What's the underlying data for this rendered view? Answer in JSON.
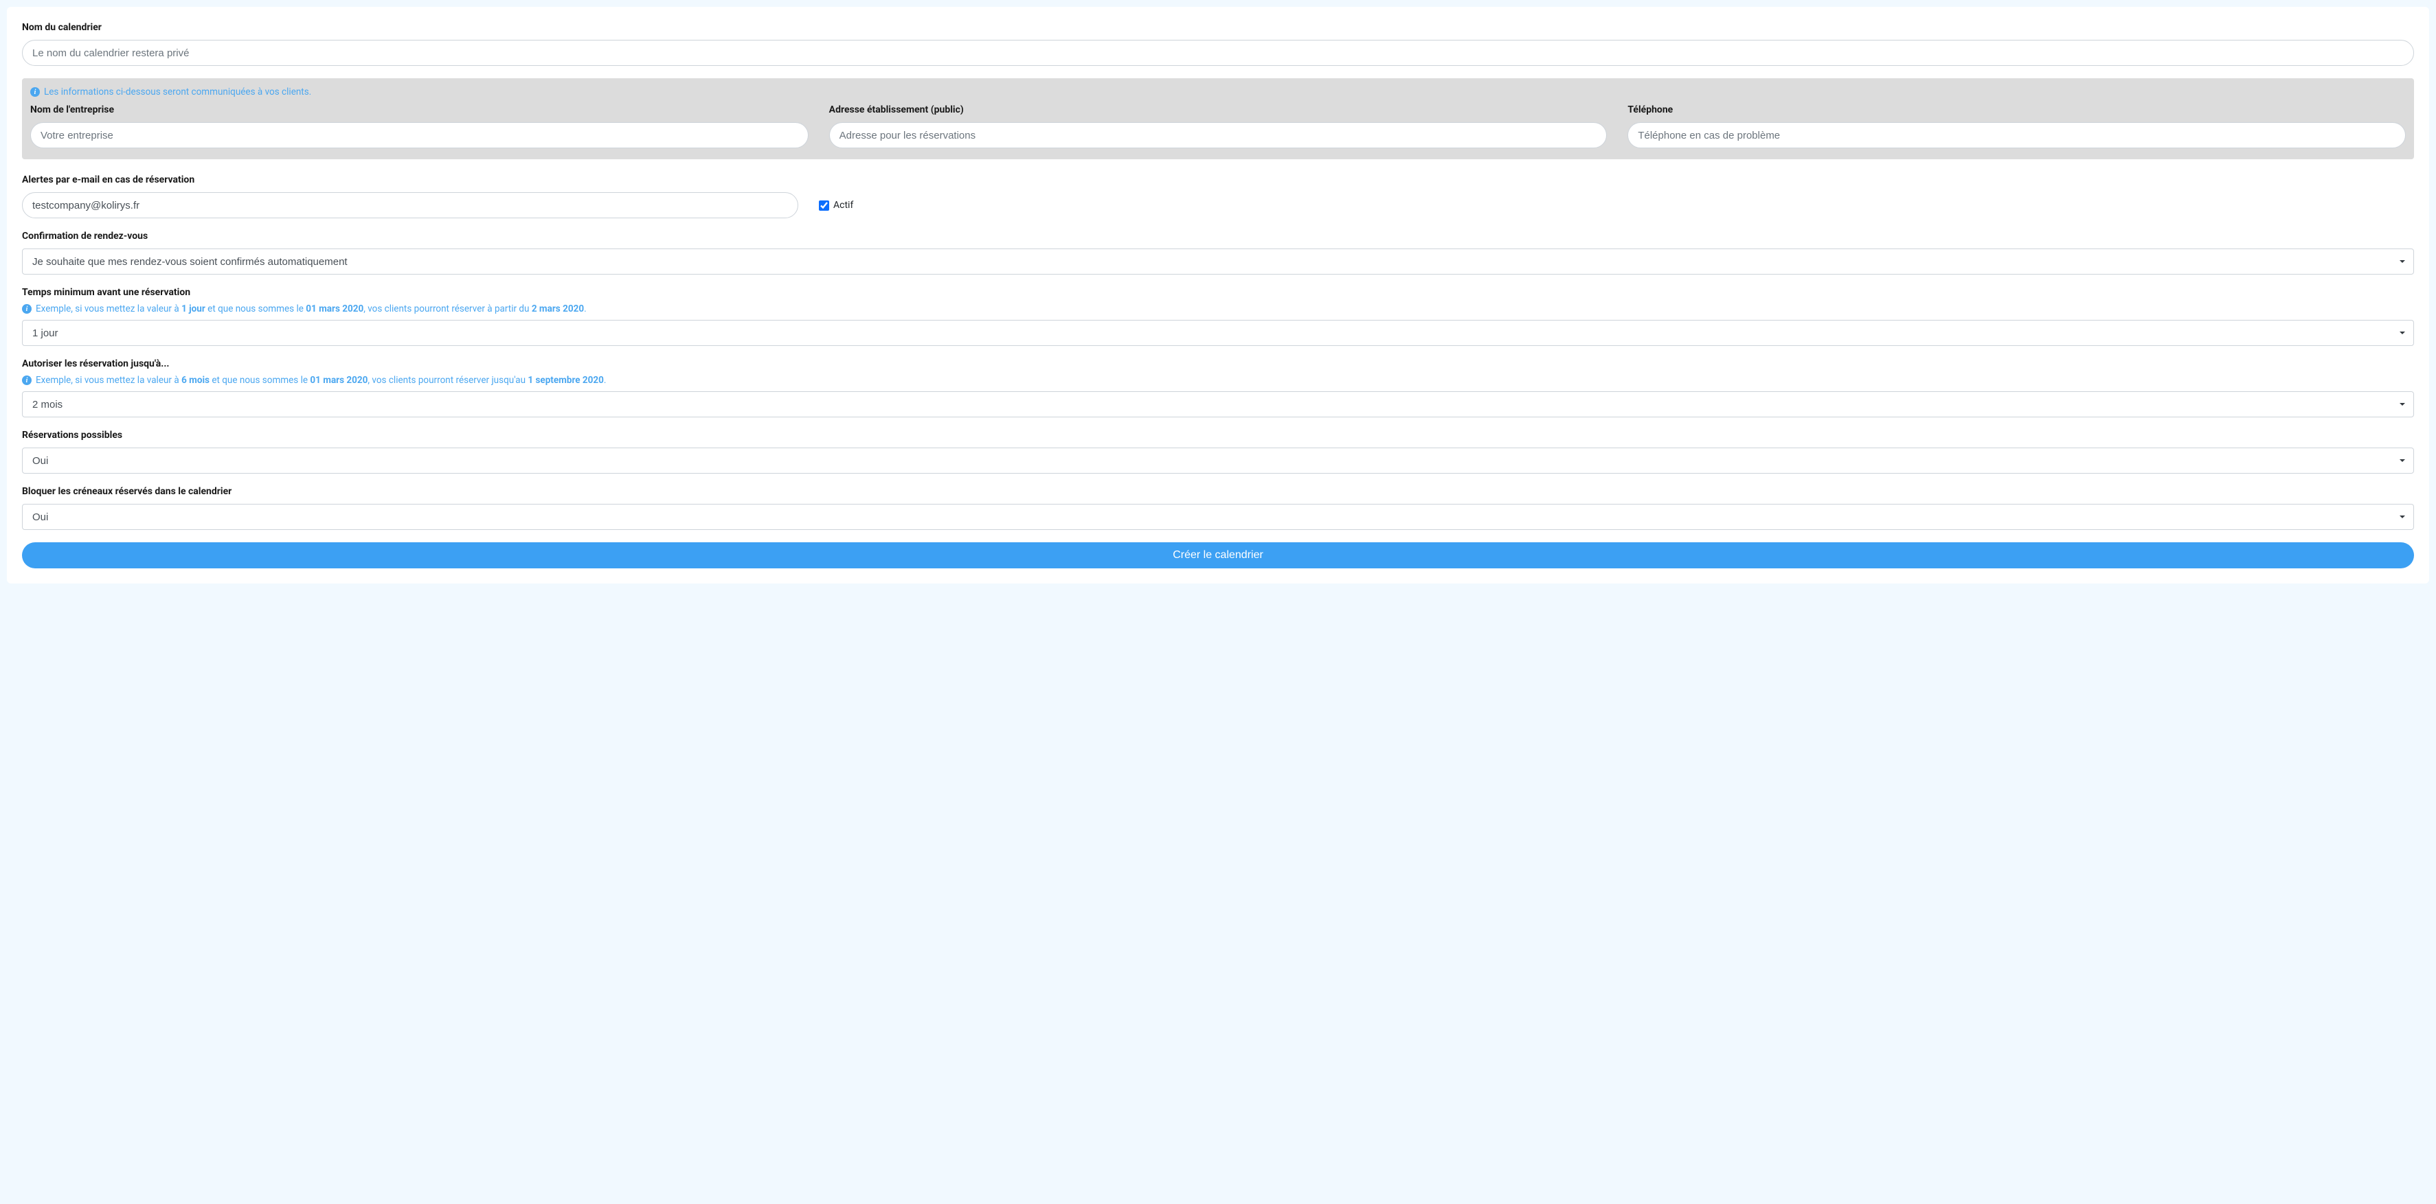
{
  "calendar_name": {
    "label": "Nom du calendrier",
    "placeholder": "Le nom du calendrier restera privé"
  },
  "public_info": {
    "notice": "Les informations ci-dessous seront communiquées à vos clients.",
    "company": {
      "label": "Nom de l'entreprise",
      "placeholder": "Votre entreprise"
    },
    "address": {
      "label": "Adresse établissement (public)",
      "placeholder": "Adresse pour les réservations"
    },
    "phone": {
      "label": "Téléphone",
      "placeholder": "Téléphone en cas de problème"
    }
  },
  "email_alerts": {
    "label": "Alertes par e-mail en cas de réservation",
    "value": "testcompany@kolirys.fr",
    "active_label": "Actif",
    "active_checked": true
  },
  "confirmation": {
    "label": "Confirmation de rendez-vous",
    "selected": "Je souhaite que mes rendez-vous soient confirmés automatiquement"
  },
  "min_time": {
    "label": "Temps minimum avant une réservation",
    "hint_prefix": "Exemple, si vous mettez la valeur à ",
    "hint_val1": "1 jour",
    "hint_mid": " et que nous sommes le ",
    "hint_date1": "01 mars 2020",
    "hint_mid2": ", vos clients pourront réserver à partir du ",
    "hint_date2": "2 mars 2020",
    "hint_suffix": ".",
    "selected": "1 jour"
  },
  "max_time": {
    "label": "Autoriser les réservation jusqu'à...",
    "hint_prefix": "Exemple, si vous mettez la valeur à ",
    "hint_val1": "6 mois",
    "hint_mid": " et que nous sommes le ",
    "hint_date1": "01 mars 2020",
    "hint_mid2": ", vos clients pourront réserver jusqu'au ",
    "hint_date2": "1 septembre 2020",
    "hint_suffix": ".",
    "selected": "2 mois"
  },
  "reservations_possible": {
    "label": "Réservations possibles",
    "selected": "Oui"
  },
  "block_slots": {
    "label": "Bloquer les créneaux réservés dans le calendrier",
    "selected": "Oui"
  },
  "submit_label": "Créer le calendrier"
}
